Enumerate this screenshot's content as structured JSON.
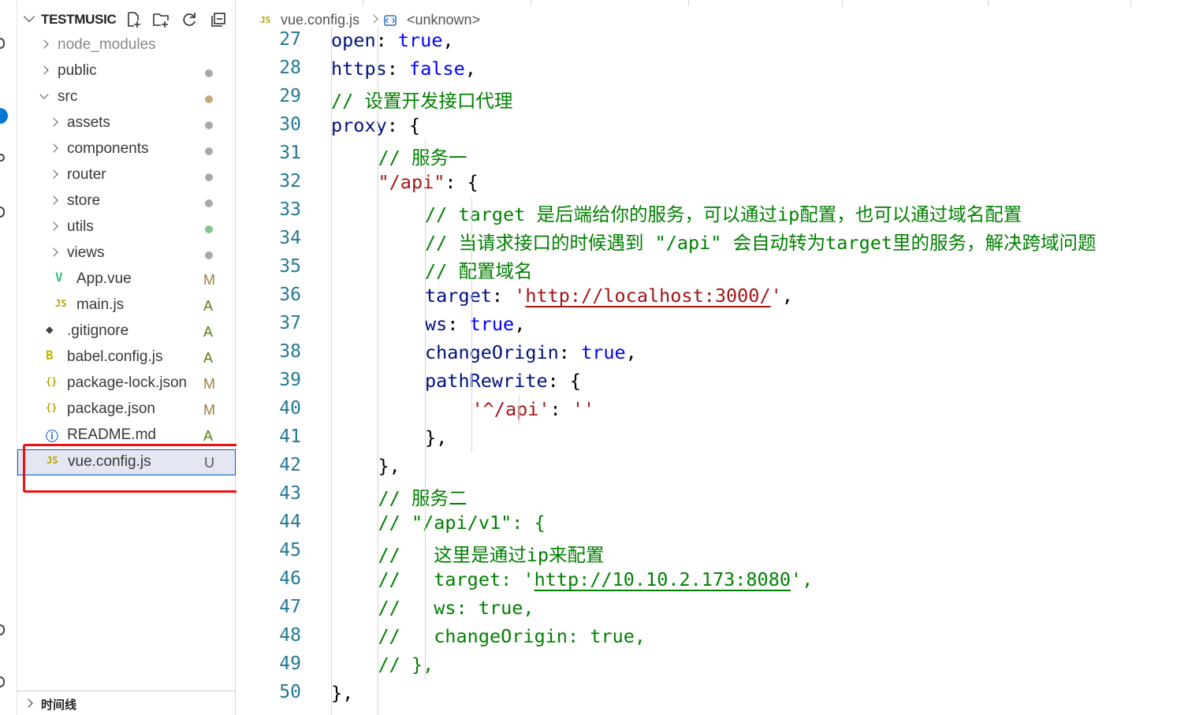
{
  "explorer": {
    "title": "TESTMUSIC",
    "header_actions": [
      "new-file-icon",
      "new-folder-icon",
      "refresh-icon",
      "collapse-all-icon"
    ],
    "items": [
      {
        "label": "node_modules",
        "kind": "folder",
        "depth": 0,
        "expanded": false,
        "status": "",
        "dim": true
      },
      {
        "label": "public",
        "kind": "folder",
        "depth": 0,
        "expanded": false,
        "status": "dot",
        "status_color": "#a8a8a8"
      },
      {
        "label": "src",
        "kind": "folder",
        "depth": 0,
        "expanded": true,
        "status": "dot",
        "status_color": "#c9a97a"
      },
      {
        "label": "assets",
        "kind": "folder",
        "depth": 1,
        "expanded": false,
        "status": "dot",
        "status_color": "#a8a8a8"
      },
      {
        "label": "components",
        "kind": "folder",
        "depth": 1,
        "expanded": false,
        "status": "dot",
        "status_color": "#a8a8a8"
      },
      {
        "label": "router",
        "kind": "folder",
        "depth": 1,
        "expanded": false,
        "status": "dot",
        "status_color": "#a8a8a8"
      },
      {
        "label": "store",
        "kind": "folder",
        "depth": 1,
        "expanded": false,
        "status": "dot",
        "status_color": "#a8a8a8"
      },
      {
        "label": "utils",
        "kind": "folder",
        "depth": 1,
        "expanded": false,
        "status": "dot",
        "status_color": "#7fc98a"
      },
      {
        "label": "views",
        "kind": "folder",
        "depth": 1,
        "expanded": false,
        "status": "dot",
        "status_color": "#a8a8a8"
      },
      {
        "label": "App.vue",
        "kind": "vue",
        "depth": 1,
        "status": "M",
        "status_color": "#a07b3c"
      },
      {
        "label": "main.js",
        "kind": "js",
        "depth": 1,
        "status": "A",
        "status_color": "#587c0c"
      },
      {
        "label": ".gitignore",
        "kind": "git",
        "depth": 0,
        "status": "A",
        "status_color": "#587c0c"
      },
      {
        "label": "babel.config.js",
        "kind": "babel",
        "depth": 0,
        "status": "A",
        "status_color": "#587c0c"
      },
      {
        "label": "package-lock.json",
        "kind": "json",
        "depth": 0,
        "status": "M",
        "status_color": "#a07b3c"
      },
      {
        "label": "package.json",
        "kind": "json",
        "depth": 0,
        "status": "M",
        "status_color": "#a07b3c"
      },
      {
        "label": "README.md",
        "kind": "info",
        "depth": 0,
        "status": "A",
        "status_color": "#587c0c"
      },
      {
        "label": "vue.config.js",
        "kind": "js",
        "depth": 0,
        "status": "U",
        "status_color": "#555555",
        "selected": true
      }
    ],
    "timeline_label": "时间线"
  },
  "breadcrumb": {
    "file_icon_text": "JS",
    "file": "vue.config.js",
    "symbol": "<unknown>"
  },
  "icons": {
    "js": "JS",
    "json": "{}",
    "vue": "V",
    "babel": "B",
    "git": "◆",
    "info": "ⓘ"
  },
  "editor": {
    "lines": [
      {
        "n": "27",
        "indent": 2,
        "tokens": [
          [
            "prop",
            "open"
          ],
          [
            "punc",
            ": "
          ],
          [
            "bool",
            "true"
          ],
          [
            "punc",
            ","
          ]
        ]
      },
      {
        "n": "28",
        "indent": 2,
        "tokens": [
          [
            "prop",
            "https"
          ],
          [
            "punc",
            ": "
          ],
          [
            "bool",
            "false"
          ],
          [
            "punc",
            ","
          ]
        ]
      },
      {
        "n": "29",
        "indent": 2,
        "tokens": [
          [
            "com",
            "// 设置开发接口代理"
          ]
        ]
      },
      {
        "n": "30",
        "indent": 2,
        "tokens": [
          [
            "prop",
            "proxy"
          ],
          [
            "punc",
            ": {"
          ]
        ]
      },
      {
        "n": "31",
        "indent": 3,
        "tokens": [
          [
            "com",
            "// 服务一"
          ]
        ]
      },
      {
        "n": "32",
        "indent": 3,
        "tokens": [
          [
            "str",
            "\"/api\""
          ],
          [
            "punc",
            ": {"
          ]
        ]
      },
      {
        "n": "33",
        "indent": 4,
        "tokens": [
          [
            "com",
            "// target 是后端给你的服务，可以通过ip配置，也可以通过域名配置"
          ]
        ]
      },
      {
        "n": "34",
        "indent": 4,
        "tokens": [
          [
            "com",
            "// 当请求接口的时候遇到 \"/api\" 会自动转为target里的服务，解决跨域问题"
          ]
        ]
      },
      {
        "n": "35",
        "indent": 4,
        "tokens": [
          [
            "com",
            "// 配置域名"
          ]
        ]
      },
      {
        "n": "36",
        "indent": 4,
        "tokens": [
          [
            "prop",
            "target"
          ],
          [
            "punc",
            ": "
          ],
          [
            "str",
            "'"
          ],
          [
            "url",
            "http://localhost:3000/"
          ],
          [
            "str",
            "'"
          ],
          [
            "punc",
            ","
          ]
        ]
      },
      {
        "n": "37",
        "indent": 4,
        "tokens": [
          [
            "prop",
            "ws"
          ],
          [
            "punc",
            ": "
          ],
          [
            "bool",
            "true"
          ],
          [
            "punc",
            ","
          ]
        ]
      },
      {
        "n": "38",
        "indent": 4,
        "tokens": [
          [
            "prop",
            "changeOrigin"
          ],
          [
            "punc",
            ": "
          ],
          [
            "bool",
            "true"
          ],
          [
            "punc",
            ","
          ]
        ]
      },
      {
        "n": "39",
        "indent": 4,
        "tokens": [
          [
            "prop",
            "pathRewrite"
          ],
          [
            "punc",
            ": {"
          ]
        ]
      },
      {
        "n": "40",
        "indent": 5,
        "tokens": [
          [
            "str",
            "'^/api'"
          ],
          [
            "punc",
            ": "
          ],
          [
            "str",
            "''"
          ]
        ]
      },
      {
        "n": "41",
        "indent": 4,
        "tokens": [
          [
            "punc",
            "},"
          ]
        ]
      },
      {
        "n": "42",
        "indent": 3,
        "tokens": [
          [
            "punc",
            "},"
          ]
        ]
      },
      {
        "n": "43",
        "indent": 3,
        "tokens": [
          [
            "com",
            "// 服务二"
          ]
        ]
      },
      {
        "n": "44",
        "indent": 3,
        "tokens": [
          [
            "com",
            "// \"/api/v1\": {"
          ]
        ]
      },
      {
        "n": "45",
        "indent": 3,
        "tokens": [
          [
            "com",
            "//   这里是通过ip来配置"
          ]
        ]
      },
      {
        "n": "46",
        "indent": 3,
        "tokens": [
          [
            "com",
            "//   target: '"
          ],
          [
            "comurl",
            "http://10.10.2.173:8080"
          ],
          [
            "com",
            "',"
          ]
        ]
      },
      {
        "n": "47",
        "indent": 3,
        "tokens": [
          [
            "com",
            "//   ws: true,"
          ]
        ]
      },
      {
        "n": "48",
        "indent": 3,
        "tokens": [
          [
            "com",
            "//   changeOrigin: true,"
          ]
        ]
      },
      {
        "n": "49",
        "indent": 3,
        "tokens": [
          [
            "com",
            "// },"
          ]
        ]
      },
      {
        "n": "50",
        "indent": 2,
        "tokens": [
          [
            "punc",
            "},"
          ]
        ]
      }
    ]
  }
}
